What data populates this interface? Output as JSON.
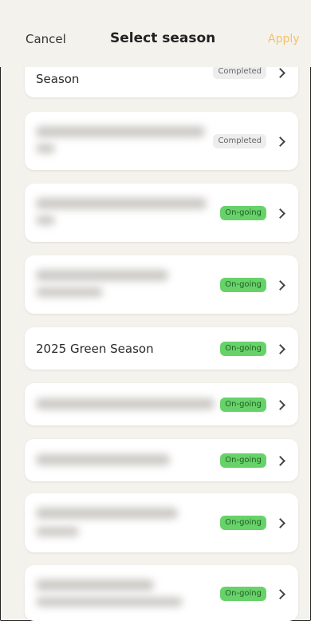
{
  "header": {
    "cancel": "Cancel",
    "title": "Select season",
    "apply": "Apply"
  },
  "colors": {
    "accent": "#f3c16c",
    "ongoing": "#67d26a",
    "completed": "#ededed"
  },
  "seasons": [
    {
      "label": "Season",
      "blurred": false,
      "status": "Completed"
    },
    {
      "label": "",
      "blurred": true,
      "status": "Completed"
    },
    {
      "label": "",
      "blurred": true,
      "status": "On-going"
    },
    {
      "label": "",
      "blurred": true,
      "status": "On-going"
    },
    {
      "label": "2025 Green Season",
      "blurred": false,
      "status": "On-going"
    },
    {
      "label": "",
      "blurred": true,
      "status": "On-going"
    },
    {
      "label": "",
      "blurred": true,
      "status": "On-going"
    },
    {
      "label": "",
      "blurred": true,
      "status": "On-going"
    },
    {
      "label": "",
      "blurred": true,
      "status": "On-going"
    }
  ]
}
